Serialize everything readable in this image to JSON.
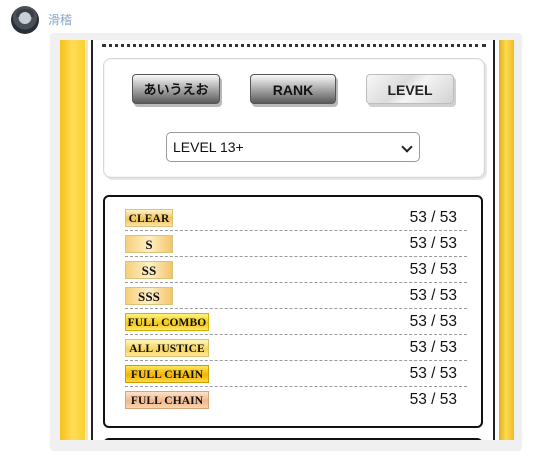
{
  "chat": {
    "username": "滑稽"
  },
  "controls": {
    "sort_buttons": [
      "あいうえお",
      "RANK",
      "LEVEL"
    ],
    "level_select": "LEVEL 13+"
  },
  "stats": [
    {
      "badge": "CLEAR",
      "value": "53 / 53"
    },
    {
      "badge": "S",
      "value": "53 / 53"
    },
    {
      "badge": "SS",
      "value": "53 / 53"
    },
    {
      "badge": "SSS",
      "value": "53 / 53"
    },
    {
      "badge": "FULL COMBO",
      "value": "53 / 53"
    },
    {
      "badge": "ALL JUSTICE",
      "value": "53 / 53"
    },
    {
      "badge": "FULL CHAIN",
      "value": "53 / 53"
    },
    {
      "badge": "FULL CHAIN",
      "value": "53 / 53"
    }
  ]
}
